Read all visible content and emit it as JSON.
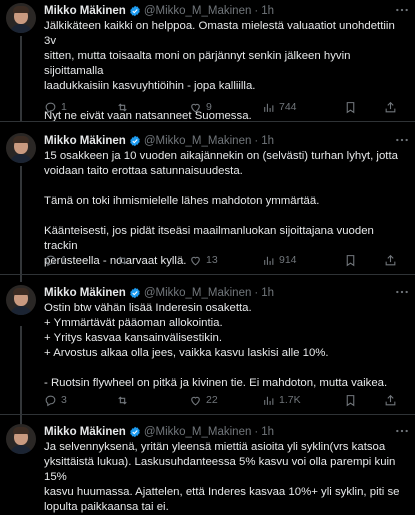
{
  "tweets": [
    {
      "author": "Mikko Mäkinen",
      "handle": "@Mikko_M_Makinen",
      "time": "1h",
      "lines": [
        "Jälkikäteen kaikki on helppoa. Omasta mielestä valuaatiot unohdettiin 3v",
        "sitten, mutta toisaalta moni on pärjännyt senkin jälkeen hyvin sijoittamalla",
        "laadukkaisiin kasvuyhtiöihin - jopa kalliilla.",
        "",
        "Nyt ne eivät vaan natsanneet Suomessa."
      ],
      "replies": "1",
      "retweets": "",
      "likes": "9",
      "views": "744"
    },
    {
      "author": "Mikko Mäkinen",
      "handle": "@Mikko_M_Makinen",
      "time": "1h",
      "lines": [
        "15 osakkeen ja 10 vuoden aikajännekin on (selvästi) turhan lyhyt, jotta",
        "voidaan taito erottaa satunnaisuudesta.",
        "",
        "Tämä on toki ihmismielelle lähes mahdoton ymmärtää.",
        "",
        "Käänteisesti, jos pidät itseäsi maailmanluokan sijoittajana vuoden trackin",
        "perusteella - no arvaat kyllä."
      ],
      "replies": "1",
      "retweets": "",
      "likes": "13",
      "views": "914"
    },
    {
      "author": "Mikko Mäkinen",
      "handle": "@Mikko_M_Makinen",
      "time": "1h",
      "lines": [
        "Ostin btw vähän lisää Inderesin osaketta.",
        "+ Ymmärtävät pääoman allokointia.",
        "+ Yritys kasvaa kansainvälisestikin.",
        "+ Arvostus alkaa olla jees, vaikka kasvu laskisi alle 10%.",
        "",
        "- Ruotsin flywheel on pitkä ja kivinen tie. Ei mahdoton, mutta vaikea."
      ],
      "replies": "3",
      "retweets": "",
      "likes": "22",
      "views": "1.7K"
    },
    {
      "author": "Mikko Mäkinen",
      "handle": "@Mikko_M_Makinen",
      "time": "1h",
      "lines": [
        "Ja selvennyksenä, yritän yleensä miettiä asioita yli syklin(vrs katsoa",
        "yksittäistä lukua). Laskusuhdanteessa 5% kasvu voi olla parempi kuin 15%",
        "kasvu huumassa. Ajattelen, että Inderes kasvaa 10%+ yli syklin, piti se",
        "lopulta paikkaansa tai ei."
      ]
    }
  ],
  "colors": {
    "background": "#000000",
    "text": "#e7e9ea",
    "muted": "#71767b",
    "verified": "#1d9bf0",
    "separator": "#2f3336"
  },
  "icons": [
    "avatar",
    "verified-badge-icon",
    "more-icon",
    "reply-icon",
    "retweet-icon",
    "like-icon",
    "views-icon",
    "bookmark-icon",
    "share-icon"
  ]
}
